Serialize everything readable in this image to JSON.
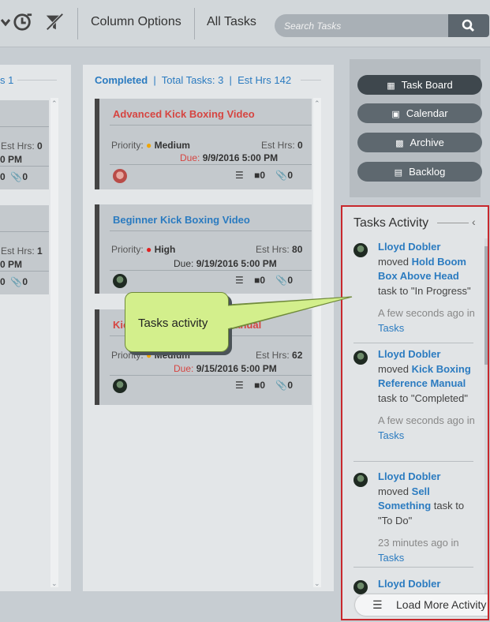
{
  "toolbar": {
    "column_options": "Column Options",
    "all_tasks": "All Tasks",
    "search_placeholder": "Search Tasks"
  },
  "left_column": {
    "header_fragment": "s 1",
    "cards": [
      {
        "est": "Est Hrs:",
        "est_value": "0",
        "due_fragment": "0 PM",
        "checklist": "0",
        "attachments": "0"
      },
      {
        "est": "Est Hrs:",
        "est_value": "1",
        "due_fragment": "0 PM",
        "checklist": "0",
        "attachments": "0"
      }
    ]
  },
  "completed_column": {
    "name": "Completed",
    "total_label": "Total Tasks:",
    "total_value": "3",
    "est_label": "Est Hrs",
    "est_value": "142",
    "cards": [
      {
        "title": "Advanced Kick Boxing Video",
        "priority_label": "Priority:",
        "priority": "Medium",
        "est_label": "Est Hrs:",
        "est_value": "0",
        "due": "Due:",
        "due_value": "9/9/2016 5:00 PM",
        "comments": "0",
        "attachments": "0"
      },
      {
        "title": "Beginner Kick Boxing Video",
        "priority_label": "Priority:",
        "priority": "High",
        "est_label": "Est Hrs:",
        "est_value": "80",
        "due": "Due:",
        "due_value": "9/19/2016 5:00 PM",
        "comments": "0",
        "attachments": "0"
      },
      {
        "title_left": "Kic",
        "title_right": "anual",
        "priority_label": "Priority:",
        "priority": "Medium",
        "est_label": "Est Hrs:",
        "est_value": "62",
        "due": "Due:",
        "due_value": "9/15/2016 5:00 PM",
        "comments": "0",
        "attachments": "0"
      }
    ]
  },
  "nav_buttons": [
    {
      "label": "Task Board",
      "icon": "grid-icon"
    },
    {
      "label": "Calendar",
      "icon": "calendar-icon"
    },
    {
      "label": "Archive",
      "icon": "archive-icon"
    },
    {
      "label": "Backlog",
      "icon": "backlog-icon"
    }
  ],
  "activity": {
    "title": "Tasks Activity",
    "items": [
      {
        "user": "Lloyd Dobler",
        "verb": "moved",
        "task": "Hold Boom Box Above Head",
        "action": "task to \"In Progress\"",
        "time": "A few seconds ago in",
        "where": "Tasks"
      },
      {
        "user": "Lloyd Dobler",
        "verb": "moved",
        "task": "Kick Boxing Reference Manual",
        "action": "task to \"Completed\"",
        "time": "A few seconds ago in",
        "where": "Tasks"
      },
      {
        "user": "Lloyd Dobler",
        "verb": "moved",
        "task": "Sell Something",
        "action": "task to \"To Do\"",
        "time": "23 minutes ago in",
        "where": "Tasks"
      },
      {
        "user": "Lloyd Dobler"
      }
    ],
    "load_more": "Load More Activity"
  },
  "callout": {
    "text": "Tasks activity"
  },
  "colors": {
    "accent_blue": "#2b7bc0",
    "due_red": "#d64541",
    "priority_medium": "#f0a500",
    "priority_high": "#e02020",
    "highlight_border": "#c8282d",
    "callout_fill": "#d3ef8c"
  }
}
